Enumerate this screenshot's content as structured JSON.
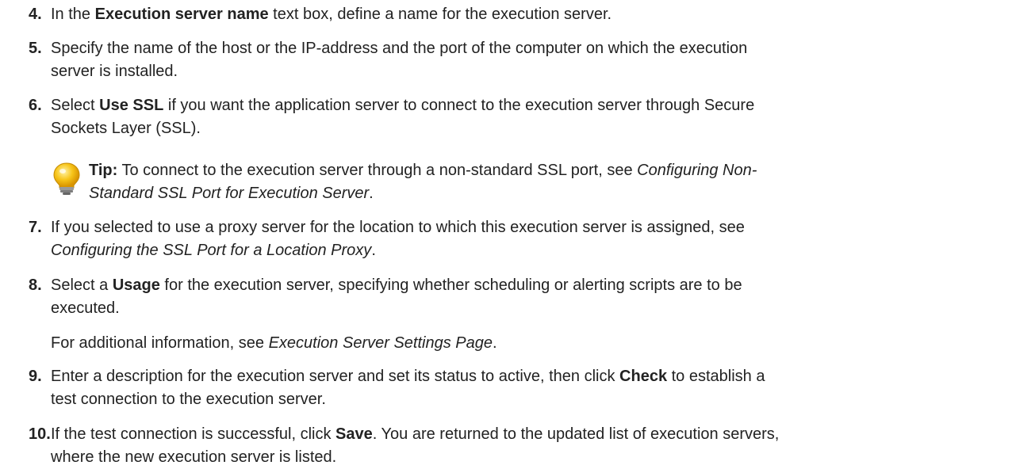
{
  "steps": [
    {
      "number": "4.",
      "parts": [
        "In the ",
        "Execution server name",
        " text box, define a name for the execution server."
      ]
    },
    {
      "number": "5.",
      "line1": "Specify the name of the host or the IP-address and the port of the computer on which the execution",
      "line2": "server is installed."
    },
    {
      "number": "6.",
      "parts": [
        "Select ",
        "Use SSL",
        " if you want the application server to connect to the execution server through Secure"
      ],
      "line2": "Sockets Layer (SSL)."
    },
    {
      "number": "7.",
      "line1": "If you selected to use a proxy server for the location to which this execution server is assigned, see",
      "link": "Configuring the SSL Port for a Location Proxy",
      "after": "."
    },
    {
      "number": "8.",
      "parts": [
        "Select a ",
        "Usage",
        " for the execution server, specifying whether scheduling or alerting scripts are to be"
      ],
      "line2": "executed."
    },
    {
      "number": "9.",
      "parts": [
        "Enter a description for the execution server and set its status to active, then click ",
        "Check",
        " to establish a"
      ],
      "line2": "test connection to the execution server."
    },
    {
      "number": "10.",
      "parts": [
        "If the test connection is successful, click ",
        "Save",
        ". You are returned to the updated list of execution servers,"
      ],
      "line2": "where the new execution server is listed."
    }
  ],
  "tip": {
    "label": "Tip:",
    "text": " To connect to the execution server through a non-standard SSL port, see ",
    "link1": "Configuring Non-",
    "link2": "Standard SSL Port for Execution Server",
    "after": "."
  },
  "note": {
    "text": "For additional information, see ",
    "link": "Execution Server Settings Page",
    "after": "."
  },
  "icon": {
    "name": "lightbulb-icon",
    "bulb_color": "#f5b800",
    "base_color": "#8a8a8a"
  }
}
